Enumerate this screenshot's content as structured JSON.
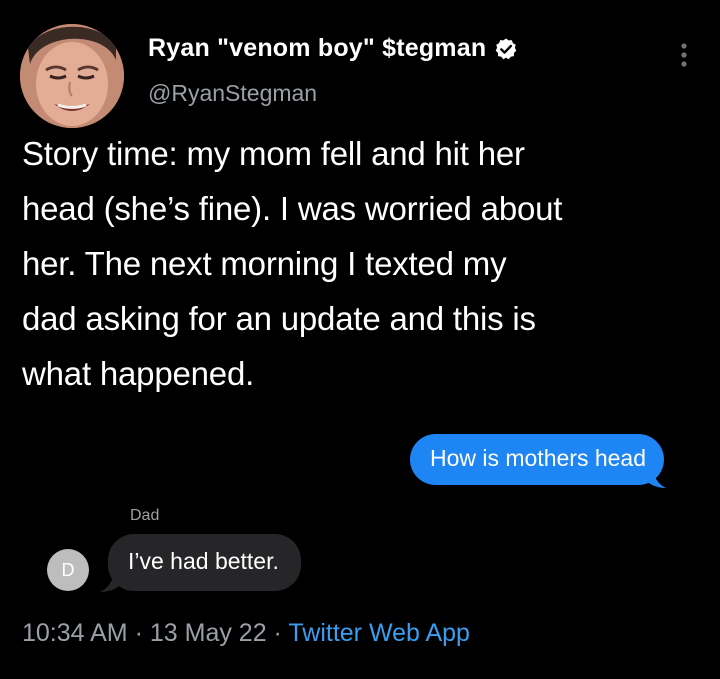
{
  "tweet": {
    "author": {
      "display_name": "Ryan \"venom boy\" $tegman",
      "handle": "@RyanStegman",
      "verified_icon": "verified-badge-icon",
      "avatar_icon": "profile-photo"
    },
    "more_icon": "more-vertical-icon",
    "text_lines": [
      "Story time: my mom fell and hit her",
      "head (she’s fine). I was worried about",
      "her. The next morning I texted my",
      "dad asking for an update and this is",
      "what happened."
    ],
    "conversation": {
      "sent_message": "How is mothers head",
      "sender_label": "Dad",
      "contact_initial": "D",
      "received_message": "I’ve had better."
    },
    "meta": {
      "time": "10:34 AM",
      "separator": " · ",
      "date": "13 May 22",
      "source": "Twitter Web App"
    },
    "colors": {
      "background": "#000000",
      "sent_bubble": "#1e85f5",
      "received_bubble": "#262629",
      "link": "#3b9df0",
      "muted": "#9aa0a6"
    }
  }
}
